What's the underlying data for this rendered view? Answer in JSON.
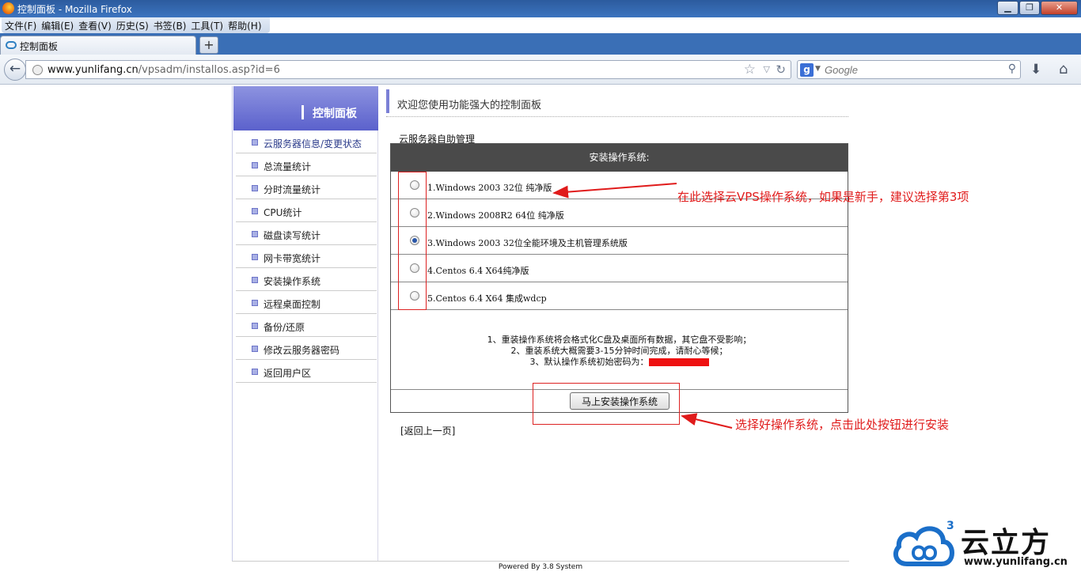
{
  "window": {
    "title": "控制面板 - Mozilla Firefox"
  },
  "menubar": [
    "文件(F)",
    "编辑(E)",
    "查看(V)",
    "历史(S)",
    "书签(B)",
    "工具(T)",
    "帮助(H)"
  ],
  "tab": {
    "label": "控制面板",
    "new_tab": "+"
  },
  "nav": {
    "url_host": "www.yunlifang.cn",
    "url_path": "/vpsadm/installos.asp?id=6",
    "search_placeholder": "Google"
  },
  "sidebar": {
    "title": "控制面板",
    "items": [
      {
        "label": "云服务器信息/变更状态"
      },
      {
        "label": "总流量统计"
      },
      {
        "label": "分时流量统计"
      },
      {
        "label": "CPU统计"
      },
      {
        "label": "磁盘读写统计"
      },
      {
        "label": "网卡带宽统计"
      },
      {
        "label": "安装操作系统"
      },
      {
        "label": "远程桌面控制"
      },
      {
        "label": "备份/还原"
      },
      {
        "label": "修改云服务器密码"
      },
      {
        "label": "返回用户区"
      }
    ]
  },
  "main": {
    "welcome": "欢迎您使用功能强大的控制面板",
    "section": "云服务器自助管理",
    "table_header": "安装操作系统:",
    "options": [
      {
        "label": "1.Windows 2003 32位 纯净版",
        "selected": false
      },
      {
        "label": "2.Windows 2008R2 64位 纯净版",
        "selected": false
      },
      {
        "label": "3.Windows 2003 32位全能环境及主机管理系统版",
        "selected": true
      },
      {
        "label": "4.Centos 6.4 X64纯净版",
        "selected": false
      },
      {
        "label": "5.Centos 6.4 X64 集成wdcp",
        "selected": false
      }
    ],
    "notes": [
      "1、重装操作系统将会格式化C盘及桌面所有数据，其它盘不受影响；",
      "2、重装系统大概需要3-15分钟时间完成，请耐心等候；",
      "3、默认操作系统初始密码为："
    ],
    "install_button": "马上安装操作系统",
    "back_link": "[返回上一页]"
  },
  "annotations": {
    "top": "在此选择云VPS操作系统，如果是新手，建议选择第3项",
    "bottom": "选择好操作系统，点击此处按钮进行安装"
  },
  "footer": "Powered By 3.8 System",
  "logo": {
    "name": "云立方",
    "url": "www.yunlifang.cn",
    "mark": "3"
  },
  "colors": {
    "accent": "#7b80d6",
    "annotation": "#e01b1b",
    "logo_blue": "#1b6fc9"
  }
}
